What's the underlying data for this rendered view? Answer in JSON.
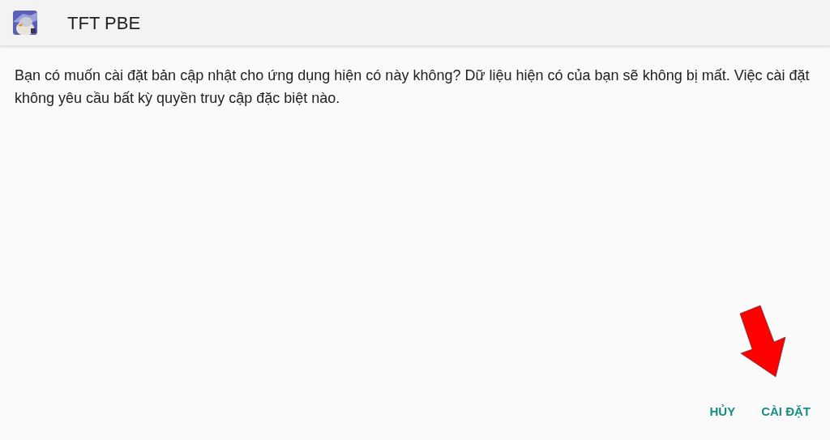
{
  "app_bar": {
    "title": "TFT PBE"
  },
  "message": "Bạn có muốn cài đặt bản cập nhật cho ứng dụng hiện có này không? Dữ liệu hiện có của bạn sẽ không bị mất. Việc cài đặt không yêu cầu bất kỳ quyền truy cập đặc biệt nào.",
  "buttons": [
    {
      "label": "HỦY"
    },
    {
      "label": "CÀI ĐẶT"
    }
  ]
}
